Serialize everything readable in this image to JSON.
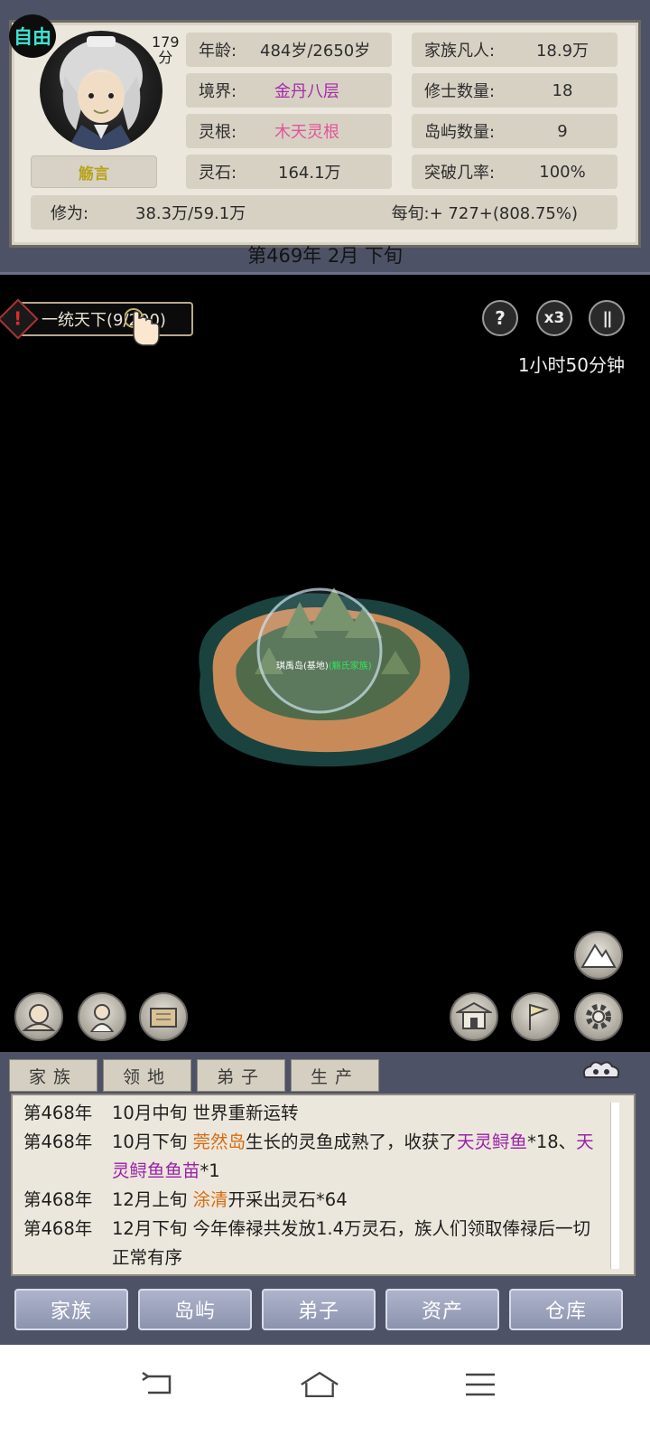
{
  "header": {
    "mode_badge": "自由",
    "score_value": "179",
    "score_unit": "分",
    "name": "觞言",
    "stats_left": [
      {
        "label": "年龄:",
        "value": "484岁/2650岁",
        "color": "#2d2d2d"
      },
      {
        "label": "境界:",
        "value": "金丹八层",
        "color": "#a52aa8"
      },
      {
        "label": "灵根:",
        "value": "木天灵根",
        "color": "#e0569a"
      },
      {
        "label": "灵石:",
        "value": "164.1万",
        "color": "#2d2d2d"
      }
    ],
    "stats_right": [
      {
        "label": "家族凡人:",
        "value": "18.9万"
      },
      {
        "label": "修士数量:",
        "value": "18"
      },
      {
        "label": "岛屿数量:",
        "value": "9"
      },
      {
        "label": "突破几率:",
        "value": "100%"
      }
    ],
    "cultivation_label": "修为:",
    "cultivation_value": "38.3万/59.1万",
    "per_period": "每旬:+ 727+(808.75%)",
    "date": "第469年 2月 下旬"
  },
  "map": {
    "quest_label": "一统天下(9/200)",
    "help_button": "?",
    "speed_button": "x3",
    "pause_button": "||",
    "timer": "1小时50分钟",
    "island_name": "琪禹岛(基地)",
    "island_family": "(觞氏家族)"
  },
  "log": {
    "tabs": [
      "家族",
      "领地",
      "弟子",
      "生产"
    ],
    "entries": [
      {
        "year": "第468年",
        "parts": [
          {
            "t": "10月中旬 世界重新运转",
            "c": ""
          }
        ]
      },
      {
        "year": "第468年",
        "parts": [
          {
            "t": "10月下旬 ",
            "c": ""
          },
          {
            "t": "莞然岛",
            "c": "c-orange"
          },
          {
            "t": "生长的灵鱼成熟了，收获了",
            "c": ""
          },
          {
            "t": "天灵鲟鱼",
            "c": "c-purple"
          },
          {
            "t": "*18、",
            "c": ""
          },
          {
            "t": "天灵鲟鱼鱼苗",
            "c": "c-purple"
          },
          {
            "t": "*1",
            "c": ""
          }
        ]
      },
      {
        "year": "第468年",
        "parts": [
          {
            "t": "12月上旬 ",
            "c": ""
          },
          {
            "t": "涂清",
            "c": "c-orange"
          },
          {
            "t": "开采出灵石*64",
            "c": ""
          }
        ]
      },
      {
        "year": "第468年",
        "parts": [
          {
            "t": "12月下旬 今年俸禄共发放1.4万灵石，族人们领取俸禄后一切正常有序",
            "c": ""
          }
        ]
      }
    ]
  },
  "nav": {
    "items": [
      "家族",
      "岛屿",
      "弟子",
      "资产",
      "仓库"
    ]
  },
  "colors": {
    "panel_bg": "#ece7dc",
    "frame": "#4d5266",
    "mode_badge": "#3ee3d4",
    "name_gold": "#b8a31c",
    "island_family_green": "#2ee65a"
  },
  "icons": {
    "map_left": [
      "fortune-teller-icon",
      "elder-portrait-icon",
      "scroll-map-icon"
    ],
    "map_right": [
      "mountain-view-icon",
      "palace-icon",
      "flag-territory-icon",
      "gear-icon"
    ],
    "log_corner": "cloud-ornament-icon",
    "system": [
      "back-icon",
      "home-icon",
      "menu-icon"
    ]
  }
}
